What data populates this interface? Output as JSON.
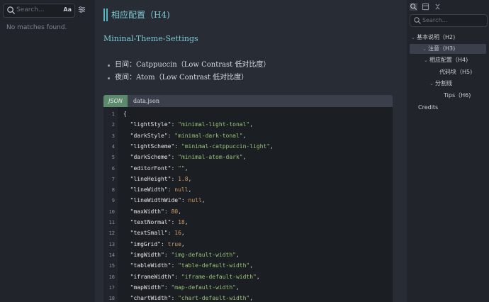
{
  "left_pane": {
    "search_placeholder": "Search...",
    "match_case_label": "Aa",
    "no_matches": "No matches found."
  },
  "document": {
    "heading_h4": "相应配置（H4)",
    "heading_h5": "Mininal-Theme-Settings",
    "bullets": [
      "日间：Catppuccin（Low Contrast 低对比度）",
      "夜间：Atom（Low Contrast 低对比度）"
    ],
    "code_block": {
      "language_tab": "JSON",
      "filename": "data.json",
      "lines": [
        {
          "n": "1",
          "text": "{"
        },
        {
          "n": "2",
          "key": "lightStyle",
          "val": "\"minimal-light-tonal\"",
          "type": "s"
        },
        {
          "n": "3",
          "key": "darkStyle",
          "val": "\"minimal-dark-tonal\"",
          "type": "s"
        },
        {
          "n": "4",
          "key": "lightScheme",
          "val": "\"minimal-catppuccin-light\"",
          "type": "s"
        },
        {
          "n": "5",
          "key": "darkScheme",
          "val": "\"minimal-atom-dark\"",
          "type": "s"
        },
        {
          "n": "6",
          "key": "editorFont",
          "val": "\"\"",
          "type": "s"
        },
        {
          "n": "7",
          "key": "lineHeight",
          "val": "1.8",
          "type": "n"
        },
        {
          "n": "8",
          "key": "lineWidth",
          "val": "null",
          "type": "n"
        },
        {
          "n": "9",
          "key": "lineWidthWide",
          "val": "null",
          "type": "n"
        },
        {
          "n": "10",
          "key": "maxWidth",
          "val": "80",
          "type": "n"
        },
        {
          "n": "11",
          "key": "textNormal",
          "val": "18",
          "type": "n"
        },
        {
          "n": "12",
          "key": "textSmall",
          "val": "16",
          "type": "n"
        },
        {
          "n": "13",
          "key": "imgGrid",
          "val": "true",
          "type": "n"
        },
        {
          "n": "14",
          "key": "imgWidth",
          "val": "\"img-default-width\"",
          "type": "s"
        },
        {
          "n": "15",
          "key": "tableWidth",
          "val": "\"table-default-width\"",
          "type": "s"
        },
        {
          "n": "16",
          "key": "iframeWidth",
          "val": "\"iframe-default-width\"",
          "type": "s"
        },
        {
          "n": "17",
          "key": "mapWidth",
          "val": "\"map-default-width\"",
          "type": "s"
        },
        {
          "n": "18",
          "key": "chartWidth",
          "val": "\"chart-default-width\"",
          "type": "s"
        }
      ]
    }
  },
  "outline": {
    "search_placeholder": "Search...",
    "items": [
      {
        "label": "基本说明（H2)",
        "twisty": "⌄"
      },
      {
        "label": "注意（H3)",
        "twisty": "⌄",
        "selected": true
      },
      {
        "label": "相应配置（H4)",
        "twisty": "⌄"
      },
      {
        "label": "代码块（H5)",
        "twisty": ""
      },
      {
        "label": "分割线",
        "twisty": "⌄"
      },
      {
        "label": "Tips（H6)",
        "twisty": ""
      },
      {
        "label": "Credits",
        "twisty": ""
      }
    ]
  }
}
